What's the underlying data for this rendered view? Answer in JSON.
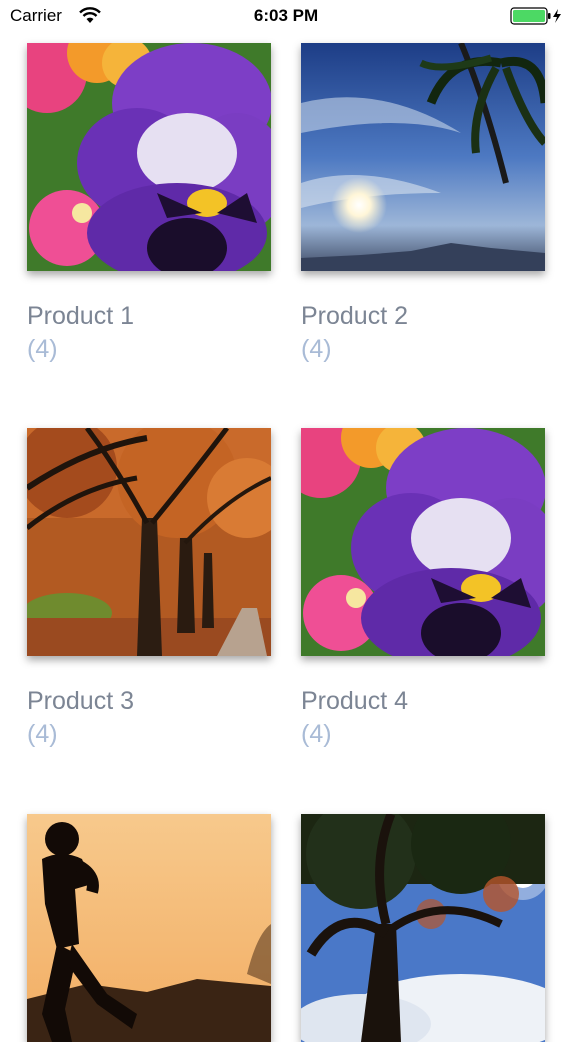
{
  "status_bar": {
    "carrier": "Carrier",
    "time": "6:03 PM",
    "wifi_icon": "wifi-icon",
    "battery_icon": "battery-charging-icon",
    "battery_color": "#4cd964"
  },
  "products": [
    {
      "name": "Product 1",
      "count": "(4)",
      "image": "pansy-flower"
    },
    {
      "name": "Product 2",
      "count": "(4)",
      "image": "palm-sky-sunset"
    },
    {
      "name": "Product 3",
      "count": "(4)",
      "image": "autumn-trees"
    },
    {
      "name": "Product 4",
      "count": "(4)",
      "image": "pansy-flower"
    },
    {
      "name": "",
      "count": "",
      "image": "runner-silhouette"
    },
    {
      "name": "",
      "count": "",
      "image": "tree-sky"
    }
  ],
  "colors": {
    "name_text": "#7c8594",
    "count_text": "#a9bbd6"
  }
}
